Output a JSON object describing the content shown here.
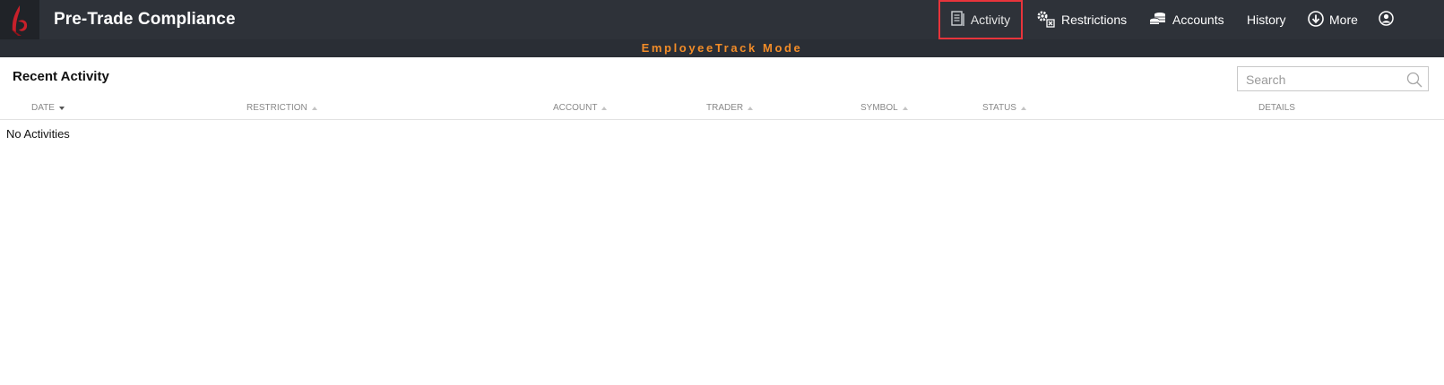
{
  "app": {
    "title": "Pre-Trade Compliance"
  },
  "nav": {
    "activity": "Activity",
    "restrictions": "Restrictions",
    "accounts": "Accounts",
    "history": "History",
    "more": "More"
  },
  "mode": {
    "text": "EmployeeTrack Mode",
    "color": "#f28c28"
  },
  "main": {
    "title": "Recent Activity",
    "search": {
      "placeholder": "Search",
      "value": ""
    },
    "columns": [
      "DATE",
      "RESTRICTION",
      "ACCOUNT",
      "TRADER",
      "SYMBOL",
      "STATUS",
      "DETAILS"
    ],
    "sort_column": "DATE",
    "sort_direction": "descending",
    "empty_message": "No Activities"
  },
  "colors": {
    "topbar": "#2e3239",
    "accent": "#e8343b",
    "mode_text": "#f28c28"
  }
}
